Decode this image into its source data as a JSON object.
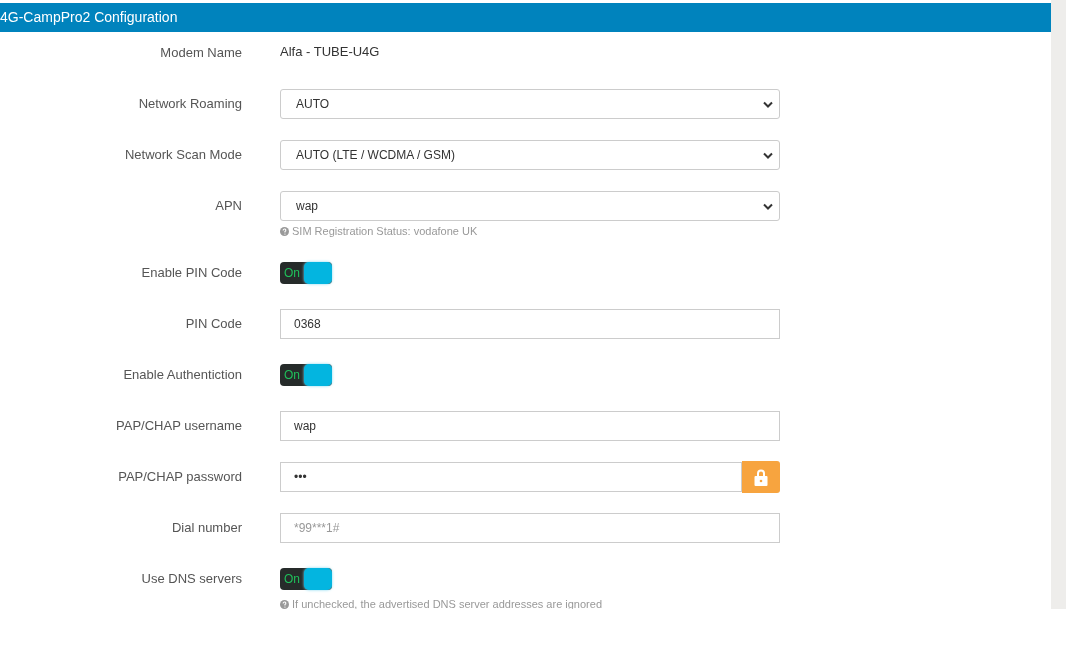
{
  "header": {
    "title": "4G-CampPro2 Configuration"
  },
  "rows": [
    {
      "kind": "text",
      "label": "Modem Name",
      "value": "Alfa - TUBE-U4G"
    },
    {
      "kind": "select",
      "label": "Network Roaming",
      "value": "AUTO"
    },
    {
      "kind": "select",
      "label": "Network Scan Mode",
      "value": "AUTO (LTE / WCDMA / GSM)"
    },
    {
      "kind": "select",
      "label": "APN",
      "value": "wap",
      "hint": "SIM Registration Status: vodafone UK"
    },
    {
      "kind": "toggle",
      "label": "Enable PIN Code",
      "on": true,
      "toggle_text": "On"
    },
    {
      "kind": "input",
      "label": "PIN Code",
      "value": "0368"
    },
    {
      "kind": "toggle",
      "label": "Enable Authentiction",
      "on": true,
      "toggle_text": "On"
    },
    {
      "kind": "input",
      "label": "PAP/CHAP username",
      "value": "wap"
    },
    {
      "kind": "password",
      "label": "PAP/CHAP password",
      "value": "•••"
    },
    {
      "kind": "input",
      "label": "Dial number",
      "placeholder": "*99***1#"
    },
    {
      "kind": "toggle",
      "label": "Use DNS servers",
      "on": true,
      "toggle_text": "On",
      "hint": "If unchecked, the advertised DNS server addresses are ignored"
    }
  ]
}
